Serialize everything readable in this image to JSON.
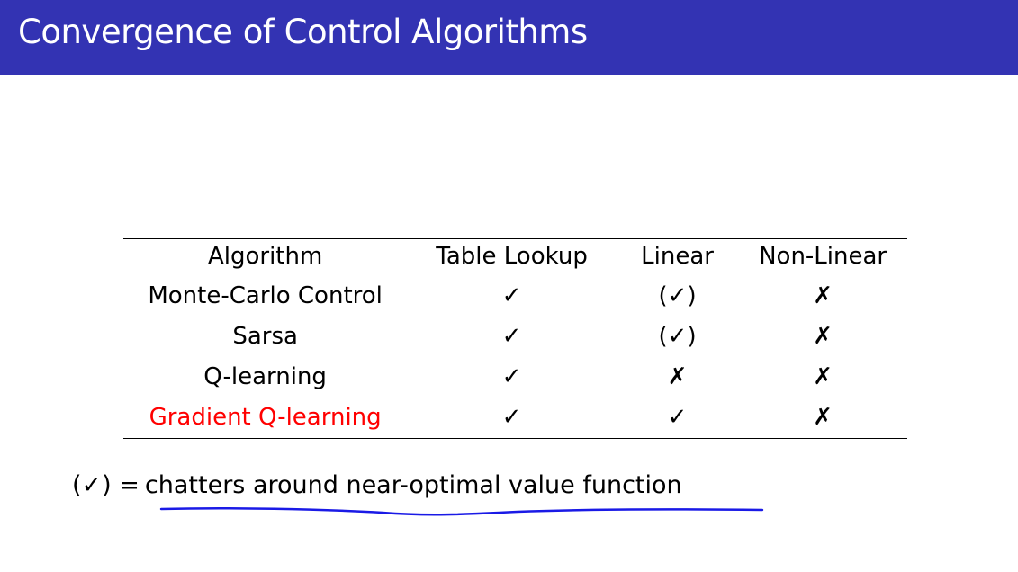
{
  "slide": {
    "title": "Convergence of Control Algorithms",
    "accent_color": "#3333b3",
    "highlight_color": "#ff0000",
    "annotation_color": "#1a1ae6"
  },
  "table": {
    "headers": [
      "Algorithm",
      "Table Lookup",
      "Linear",
      "Non-Linear"
    ],
    "rows": [
      {
        "algorithm": "Monte-Carlo Control",
        "table_lookup": "✓",
        "linear": "(✓)",
        "non_linear": "✗",
        "highlighted": false
      },
      {
        "algorithm": "Sarsa",
        "table_lookup": "✓",
        "linear": "(✓)",
        "non_linear": "✗",
        "highlighted": false
      },
      {
        "algorithm": "Q-learning",
        "table_lookup": "✓",
        "linear": "✗",
        "non_linear": "✗",
        "highlighted": false
      },
      {
        "algorithm": "Gradient Q-learning",
        "table_lookup": "✓",
        "linear": "✓",
        "non_linear": "✗",
        "highlighted": true
      }
    ]
  },
  "footnote": {
    "symbol": "(✓) =",
    "text": "chatters around near-optimal value function"
  }
}
